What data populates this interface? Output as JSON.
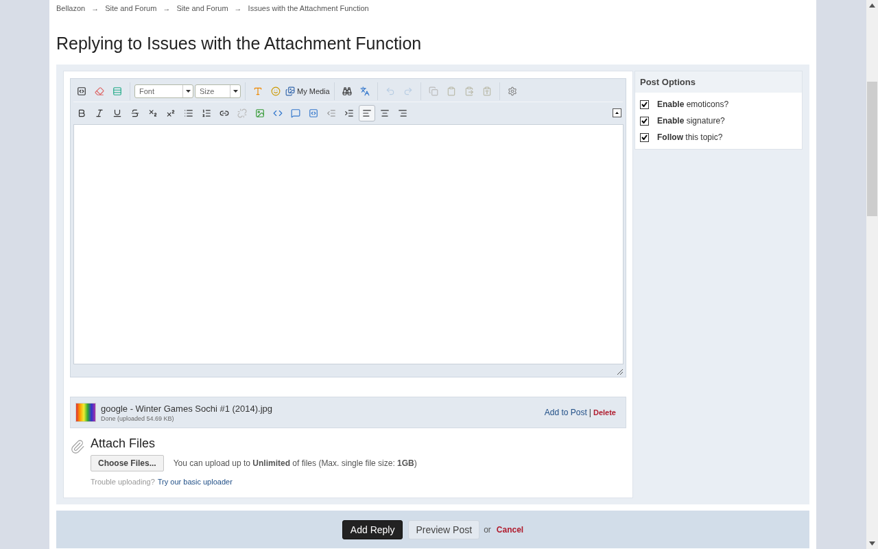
{
  "breadcrumb": [
    "Bellazon",
    "Site and Forum",
    "Site and Forum",
    "Issues with the Attachment Function"
  ],
  "breadcrumb_separator": "→",
  "title": "Replying to Issues with the Attachment Function",
  "editor": {
    "font_select": "Font",
    "size_select": "Size",
    "media_button": "My Media",
    "history_buttons": [
      {
        "disabled": true
      },
      {
        "disabled": true
      }
    ],
    "align_buttons": [
      {
        "selected": true
      },
      {
        "selected": false
      },
      {
        "selected": false
      }
    ]
  },
  "attachment": {
    "filename": "google - Winter Games Sochi #1 (2014).jpg",
    "status": "Done (uploaded 54.69 KB)",
    "add_link": "Add to Post",
    "separator": "|",
    "delete_link": "Delete"
  },
  "attach_files": {
    "heading": "Attach Files",
    "button": "Choose Files...",
    "info": "You can upload up to **Unlimited** of files (Max. single file size: **1GB**)",
    "trouble": "Trouble uploading?",
    "basic_link": "Try our basic uploader"
  },
  "post_options": {
    "title": "Post Options",
    "options": [
      {
        "label": "**Enable** emoticons?",
        "checked": true
      },
      {
        "label": "**Enable** signature?",
        "checked": true
      },
      {
        "label": "**Follow** this topic?",
        "checked": true
      }
    ]
  },
  "actions": {
    "submit": "Add Reply",
    "preview": "Preview Post",
    "or": "or",
    "cancel": "Cancel"
  }
}
